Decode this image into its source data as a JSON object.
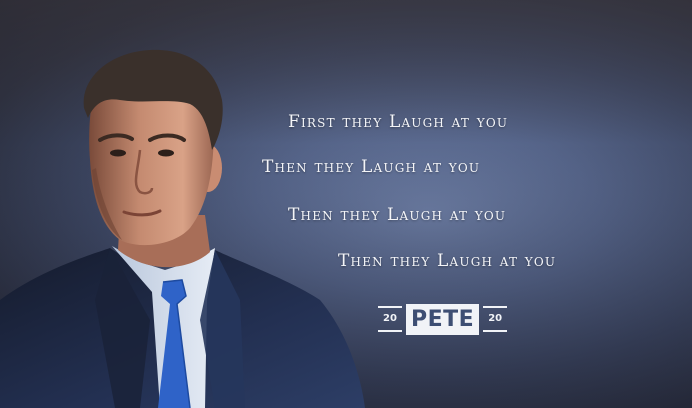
{
  "quote": {
    "line1": "First they Laugh at you",
    "line2": "Then they Laugh at you",
    "line3": "Then they Laugh at you",
    "line4": "Then they Laugh at you"
  },
  "logo": {
    "year_left": "20",
    "name": "PETE",
    "year_right": "20"
  },
  "colors": {
    "background": "#4c5878",
    "text": "#f4f5f8",
    "logo_blue": "#3d4e73",
    "tie": "#2f63c8"
  }
}
